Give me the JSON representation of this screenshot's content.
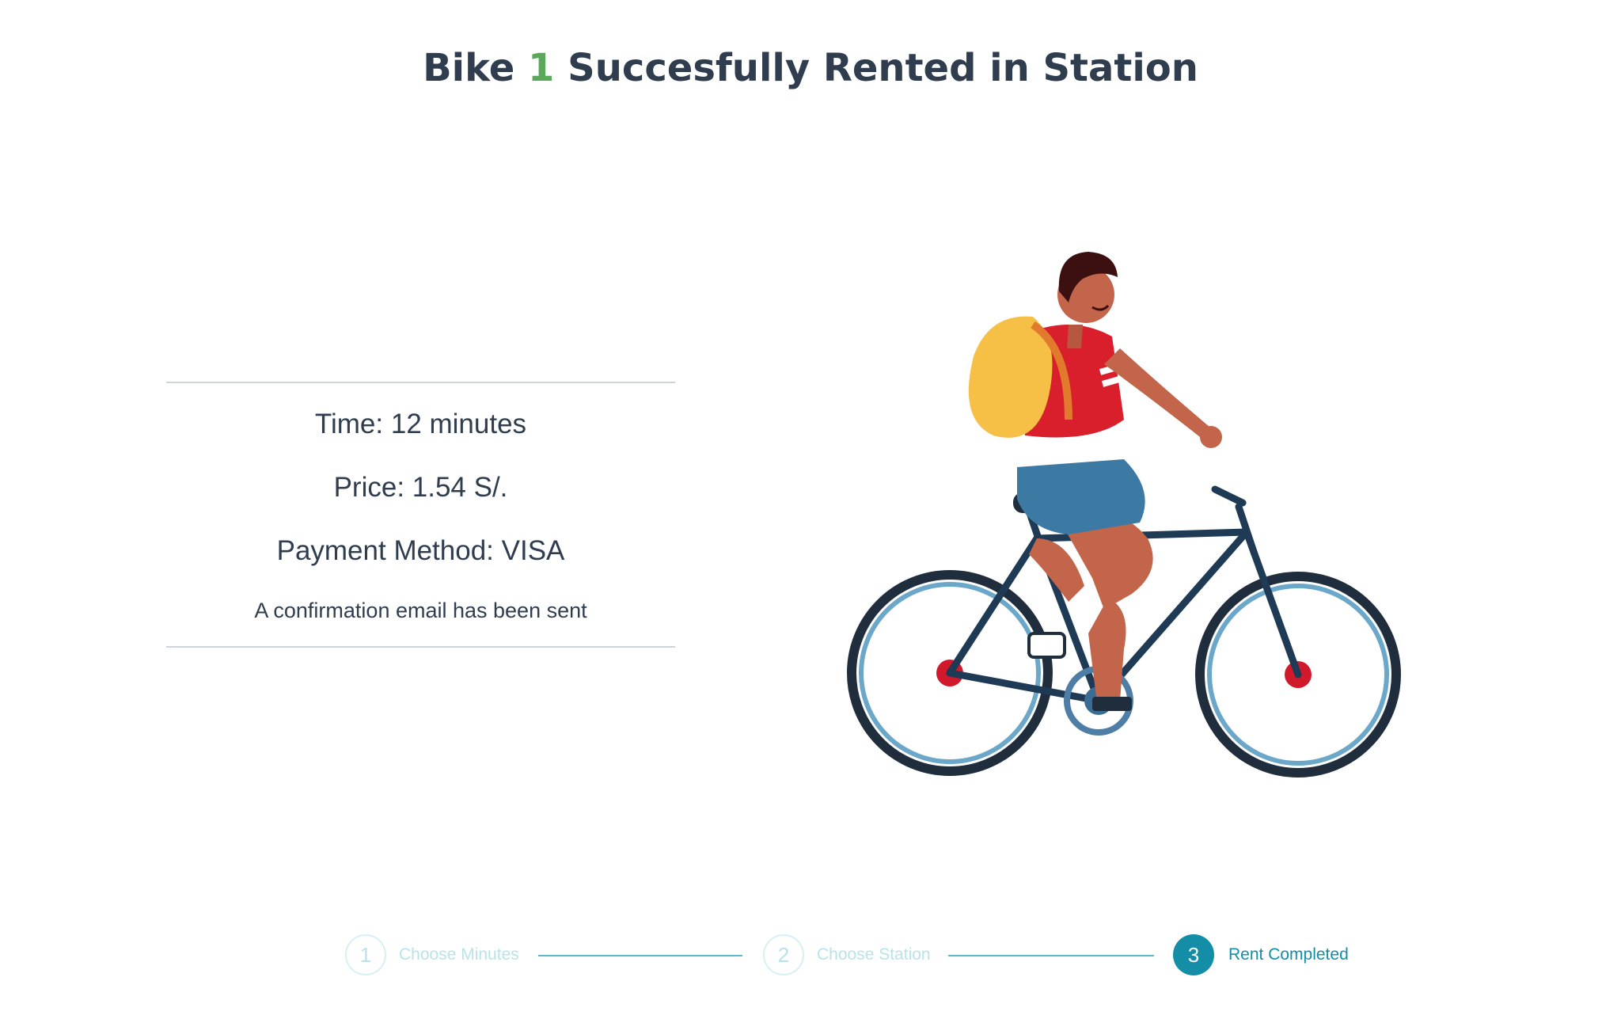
{
  "header": {
    "title_prefix": "Bike",
    "bike_number": "1",
    "title_suffix": "Succesfully Rented in Station"
  },
  "summary": {
    "time": "Time: 12 minutes",
    "price": "Price: 1.54 S/.",
    "payment_method": "Payment Method: VISA",
    "email_notice": "A confirmation email has been sent"
  },
  "illustration": {
    "icon": "cyclist-illustration"
  },
  "stepper": {
    "steps": [
      {
        "number": "1",
        "label": "Choose Minutes",
        "state": "inactive"
      },
      {
        "number": "2",
        "label": "Choose Station",
        "state": "inactive"
      },
      {
        "number": "3",
        "label": "Rent Completed",
        "state": "active"
      }
    ]
  },
  "colors": {
    "accent": "#138ea6",
    "bike_number": "#5aa95a",
    "title_text": "#2f3d4f"
  }
}
